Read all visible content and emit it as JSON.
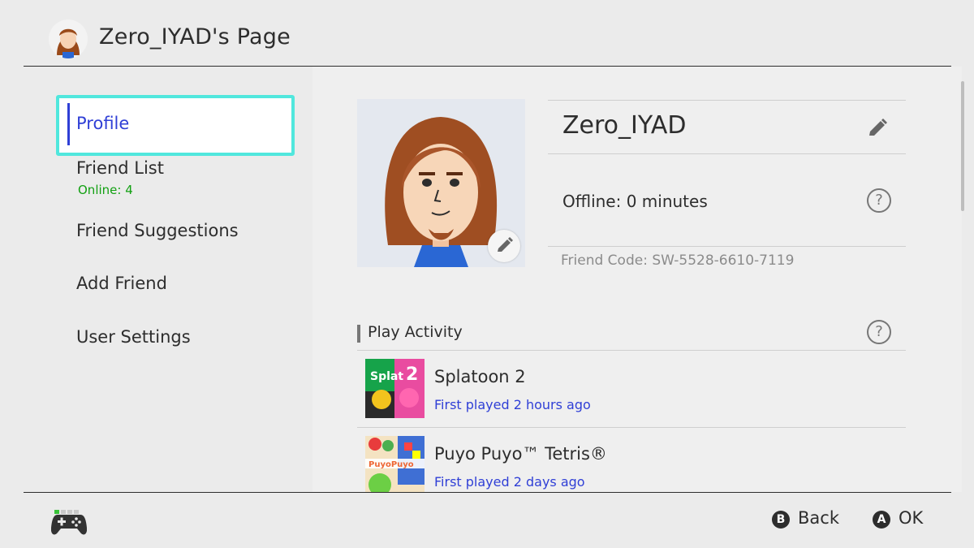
{
  "header": {
    "title": "Zero_IYAD's Page"
  },
  "sidebar": {
    "items": [
      {
        "label": "Profile",
        "selected": true
      },
      {
        "label": "Friend List",
        "sub": "Online: 4"
      },
      {
        "label": "Friend Suggestions"
      },
      {
        "label": "Add Friend"
      },
      {
        "label": "User Settings"
      }
    ]
  },
  "profile": {
    "name": "Zero_IYAD",
    "status": "Offline: 0 minutes",
    "friend_code": "Friend Code: SW-5528-6610-7119"
  },
  "play_activity": {
    "title": "Play Activity",
    "games": [
      {
        "title": "Splatoon 2",
        "played": "First played 2 hours ago"
      },
      {
        "title": "Puyo Puyo™ Tetris®",
        "played": "First played 2 days ago"
      }
    ]
  },
  "footer": {
    "back_button": "B",
    "back_label": "Back",
    "ok_button": "A",
    "ok_label": "OK"
  },
  "colors": {
    "accent": "#2f3fd6",
    "selection_frame": "#50e7dd",
    "online_text": "#12a012"
  },
  "icons": {
    "controller": "controller-icon",
    "edit": "pencil-icon",
    "help": "help-icon"
  }
}
